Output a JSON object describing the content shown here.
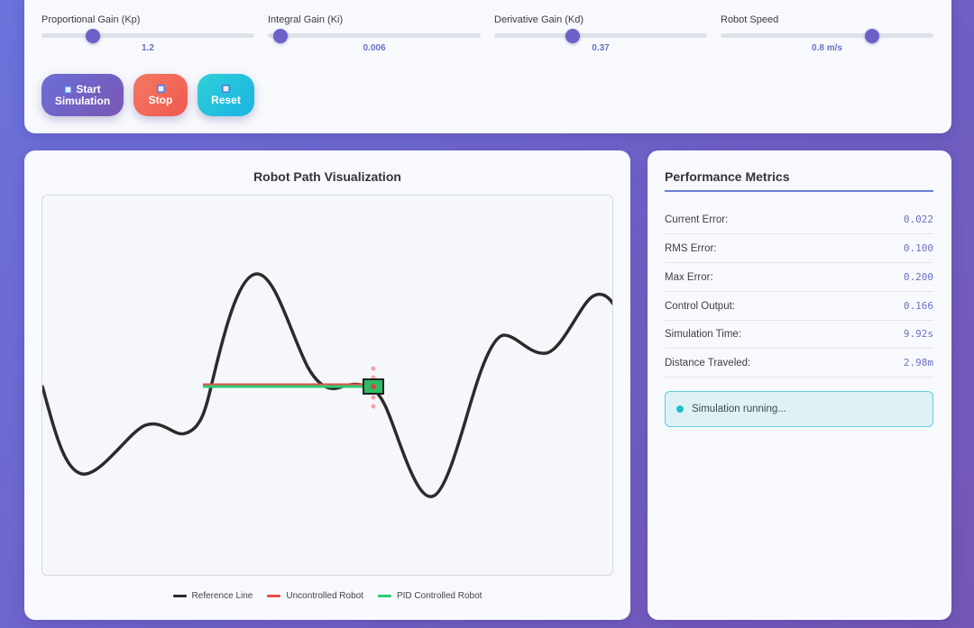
{
  "sliders": [
    {
      "label": "Proportional Gain (Kp)",
      "value": "1.2",
      "fraction": 0.24
    },
    {
      "label": "Integral Gain (Ki)",
      "value": "0.006",
      "fraction": 0.06
    },
    {
      "label": "Derivative Gain (Kd)",
      "value": "0.37",
      "fraction": 0.37
    },
    {
      "label": "Robot Speed",
      "value": "0.8 m/s",
      "fraction": 0.71
    }
  ],
  "buttons": {
    "start_line1": "Start",
    "start_line2": "Simulation",
    "stop": "Stop",
    "reset": "Reset"
  },
  "visualization": {
    "title": "Robot Path Visualization",
    "legend": [
      {
        "label": "Reference Line",
        "color": "#2b2b2b"
      },
      {
        "label": "Uncontrolled Robot",
        "color": "#e84c4c"
      },
      {
        "label": "PID Controlled Robot",
        "color": "#2ecc71"
      }
    ]
  },
  "metrics": {
    "title": "Performance Metrics",
    "rows": [
      {
        "label": "Current Error:",
        "value": "0.022"
      },
      {
        "label": "RMS Error:",
        "value": "0.100"
      },
      {
        "label": "Max Error:",
        "value": "0.200"
      },
      {
        "label": "Control Output:",
        "value": "0.166"
      },
      {
        "label": "Simulation Time:",
        "value": "9.92s"
      },
      {
        "label": "Distance Traveled:",
        "value": "2.98m"
      }
    ],
    "status": "Simulation running..."
  },
  "colors": {
    "accent": "#6b62c8",
    "reference": "#2b2b2b",
    "uncontrolled": "#e84c4c",
    "pid": "#2ecc71"
  }
}
